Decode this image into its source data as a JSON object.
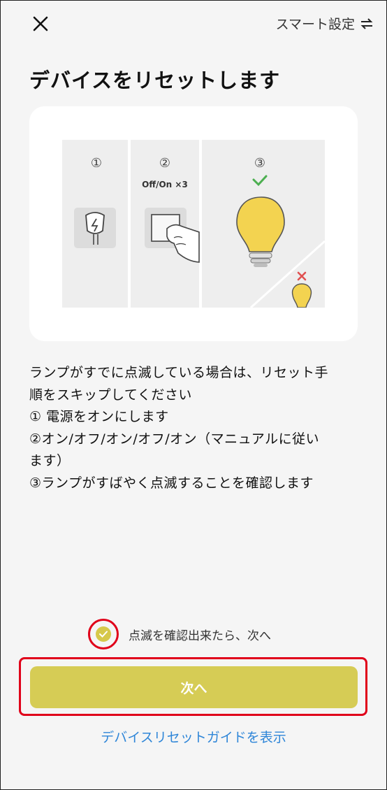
{
  "header": {
    "smart_label": "スマート設定",
    "swap_icon": "swap-arrows-icon",
    "close_icon": "close-icon"
  },
  "title": "デバイスをリセットします",
  "illustration": {
    "step1": "①",
    "step2": "②",
    "step2_caption": "Off/On ×3",
    "step3": "③"
  },
  "description": [
    "ランプがすでに点滅している場合は、リセット手",
    "順をスキップしてください",
    "① 電源をオンにします",
    "②オン/オフ/オン/オフ/オン（マニュアルに従い",
    "ます）",
    "③ランプがすばやく点滅することを確認します"
  ],
  "confirm": {
    "label": "点滅を確認出来たら、次へ",
    "checked": true
  },
  "next_button": "次へ",
  "guide_link": "デバイスリセットガイドを表示",
  "colors": {
    "accent": "#d6cc55",
    "highlight": "#e0001a",
    "link": "#2f86d8",
    "check_green": "#4caf50",
    "cross_red": "#e05050",
    "bulb": "#f3d350"
  }
}
